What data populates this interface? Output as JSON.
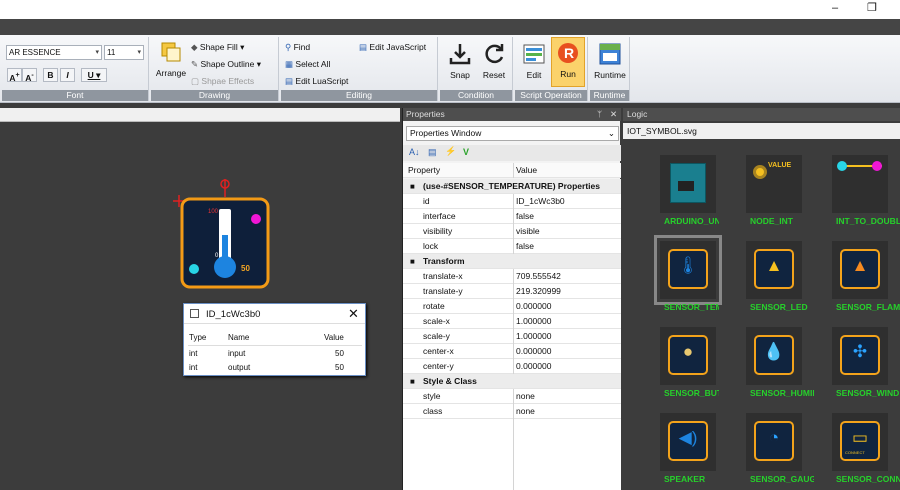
{
  "window": {
    "minimize": "–",
    "restore": "❐"
  },
  "ribbon": {
    "font_name": "AR ESSENCE",
    "font_size": "11",
    "groups": [
      "Font",
      "Drawing",
      "Editing",
      "Condition",
      "Script Operation",
      "Runtime"
    ],
    "drawing": {
      "arrange": "Arrange",
      "shape_fill": "Shape Fill",
      "shape_outline": "Shape Outline",
      "shape_effects": "Shpae Effects"
    },
    "editing": {
      "find": "Find",
      "select_all": "Select All",
      "edit_luascript": "Edit LuaScript",
      "edit_javascript": "Edit JavaScript"
    },
    "condition": {
      "snap": "Snap",
      "reset": "Reset"
    },
    "script": {
      "edit": "Edit",
      "run": "Run"
    },
    "runtime": {
      "runtime": "Runtime"
    }
  },
  "popup": {
    "title": "ID_1cWc3b0",
    "columns": [
      "Type",
      "Name",
      "Value"
    ],
    "rows": [
      {
        "type": "int",
        "name": "input",
        "value": "50"
      },
      {
        "type": "int",
        "name": "output",
        "value": "50"
      }
    ]
  },
  "thermo": {
    "top": "100",
    "mid": "0",
    "value": "50"
  },
  "properties": {
    "title": "Properties",
    "dropdown": "Properties Window",
    "col_property": "Property",
    "col_value": "Value",
    "groups": [
      {
        "name": "(use-#SENSOR_TEMPERATURE) Properties",
        "rows": [
          {
            "k": "id",
            "v": "ID_1cWc3b0"
          },
          {
            "k": "interface",
            "v": "false"
          },
          {
            "k": "visibility",
            "v": "visible"
          },
          {
            "k": "lock",
            "v": "false"
          }
        ]
      },
      {
        "name": "Transform",
        "rows": [
          {
            "k": "translate-x",
            "v": "709.555542"
          },
          {
            "k": "translate-y",
            "v": "219.320999"
          },
          {
            "k": "rotate",
            "v": "0.000000"
          },
          {
            "k": "scale-x",
            "v": "1.000000"
          },
          {
            "k": "scale-y",
            "v": "1.000000"
          },
          {
            "k": "center-x",
            "v": "0.000000"
          },
          {
            "k": "center-y",
            "v": "0.000000"
          }
        ]
      },
      {
        "name": "Style & Class",
        "rows": [
          {
            "k": "style",
            "v": "none"
          },
          {
            "k": "class",
            "v": "none"
          }
        ]
      }
    ]
  },
  "logic": {
    "title": "Logic",
    "file": "IOT_SYMBOL.svg",
    "items": [
      "ARDUINO_UNO",
      "NODE_INT",
      "INT_TO_DOUBLE",
      "SENSOR_TEMPERATURE",
      "SENSOR_LED",
      "SENSOR_FLAME",
      "SENSOR_BUTTON",
      "SENSOR_HUMIDITY",
      "SENSOR_WIND",
      "SPEAKER",
      "SENSOR_GAUGE",
      "SENSOR_CONNECT"
    ],
    "node_value": "VALUE",
    "connect_text": "CONNECT"
  }
}
